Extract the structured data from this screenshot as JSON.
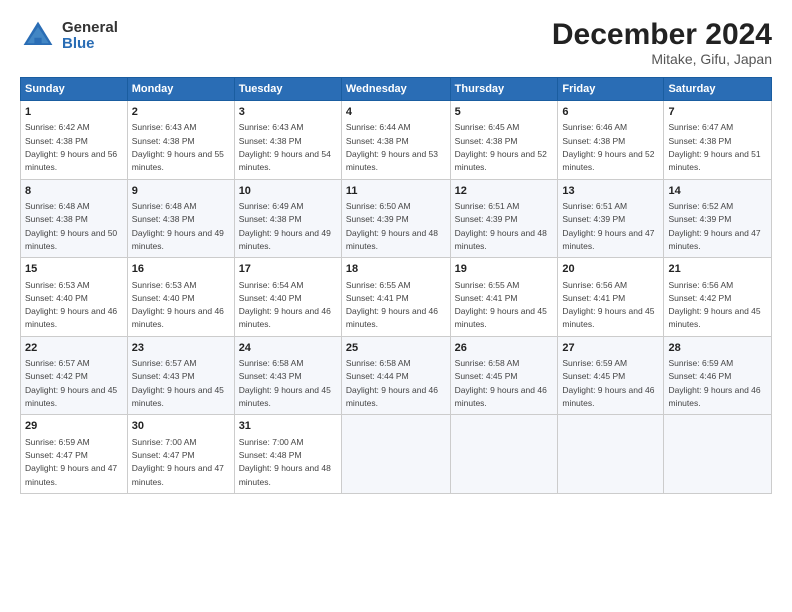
{
  "logo": {
    "general": "General",
    "blue": "Blue"
  },
  "header": {
    "month": "December 2024",
    "location": "Mitake, Gifu, Japan"
  },
  "weekdays": [
    "Sunday",
    "Monday",
    "Tuesday",
    "Wednesday",
    "Thursday",
    "Friday",
    "Saturday"
  ],
  "rows": [
    [
      {
        "day": "1",
        "sunrise": "6:42 AM",
        "sunset": "4:38 PM",
        "daylight": "9 hours and 56 minutes."
      },
      {
        "day": "2",
        "sunrise": "6:43 AM",
        "sunset": "4:38 PM",
        "daylight": "9 hours and 55 minutes."
      },
      {
        "day": "3",
        "sunrise": "6:43 AM",
        "sunset": "4:38 PM",
        "daylight": "9 hours and 54 minutes."
      },
      {
        "day": "4",
        "sunrise": "6:44 AM",
        "sunset": "4:38 PM",
        "daylight": "9 hours and 53 minutes."
      },
      {
        "day": "5",
        "sunrise": "6:45 AM",
        "sunset": "4:38 PM",
        "daylight": "9 hours and 52 minutes."
      },
      {
        "day": "6",
        "sunrise": "6:46 AM",
        "sunset": "4:38 PM",
        "daylight": "9 hours and 52 minutes."
      },
      {
        "day": "7",
        "sunrise": "6:47 AM",
        "sunset": "4:38 PM",
        "daylight": "9 hours and 51 minutes."
      }
    ],
    [
      {
        "day": "8",
        "sunrise": "6:48 AM",
        "sunset": "4:38 PM",
        "daylight": "9 hours and 50 minutes."
      },
      {
        "day": "9",
        "sunrise": "6:48 AM",
        "sunset": "4:38 PM",
        "daylight": "9 hours and 49 minutes."
      },
      {
        "day": "10",
        "sunrise": "6:49 AM",
        "sunset": "4:38 PM",
        "daylight": "9 hours and 49 minutes."
      },
      {
        "day": "11",
        "sunrise": "6:50 AM",
        "sunset": "4:39 PM",
        "daylight": "9 hours and 48 minutes."
      },
      {
        "day": "12",
        "sunrise": "6:51 AM",
        "sunset": "4:39 PM",
        "daylight": "9 hours and 48 minutes."
      },
      {
        "day": "13",
        "sunrise": "6:51 AM",
        "sunset": "4:39 PM",
        "daylight": "9 hours and 47 minutes."
      },
      {
        "day": "14",
        "sunrise": "6:52 AM",
        "sunset": "4:39 PM",
        "daylight": "9 hours and 47 minutes."
      }
    ],
    [
      {
        "day": "15",
        "sunrise": "6:53 AM",
        "sunset": "4:40 PM",
        "daylight": "9 hours and 46 minutes."
      },
      {
        "day": "16",
        "sunrise": "6:53 AM",
        "sunset": "4:40 PM",
        "daylight": "9 hours and 46 minutes."
      },
      {
        "day": "17",
        "sunrise": "6:54 AM",
        "sunset": "4:40 PM",
        "daylight": "9 hours and 46 minutes."
      },
      {
        "day": "18",
        "sunrise": "6:55 AM",
        "sunset": "4:41 PM",
        "daylight": "9 hours and 46 minutes."
      },
      {
        "day": "19",
        "sunrise": "6:55 AM",
        "sunset": "4:41 PM",
        "daylight": "9 hours and 45 minutes."
      },
      {
        "day": "20",
        "sunrise": "6:56 AM",
        "sunset": "4:41 PM",
        "daylight": "9 hours and 45 minutes."
      },
      {
        "day": "21",
        "sunrise": "6:56 AM",
        "sunset": "4:42 PM",
        "daylight": "9 hours and 45 minutes."
      }
    ],
    [
      {
        "day": "22",
        "sunrise": "6:57 AM",
        "sunset": "4:42 PM",
        "daylight": "9 hours and 45 minutes."
      },
      {
        "day": "23",
        "sunrise": "6:57 AM",
        "sunset": "4:43 PM",
        "daylight": "9 hours and 45 minutes."
      },
      {
        "day": "24",
        "sunrise": "6:58 AM",
        "sunset": "4:43 PM",
        "daylight": "9 hours and 45 minutes."
      },
      {
        "day": "25",
        "sunrise": "6:58 AM",
        "sunset": "4:44 PM",
        "daylight": "9 hours and 46 minutes."
      },
      {
        "day": "26",
        "sunrise": "6:58 AM",
        "sunset": "4:45 PM",
        "daylight": "9 hours and 46 minutes."
      },
      {
        "day": "27",
        "sunrise": "6:59 AM",
        "sunset": "4:45 PM",
        "daylight": "9 hours and 46 minutes."
      },
      {
        "day": "28",
        "sunrise": "6:59 AM",
        "sunset": "4:46 PM",
        "daylight": "9 hours and 46 minutes."
      }
    ],
    [
      {
        "day": "29",
        "sunrise": "6:59 AM",
        "sunset": "4:47 PM",
        "daylight": "9 hours and 47 minutes."
      },
      {
        "day": "30",
        "sunrise": "7:00 AM",
        "sunset": "4:47 PM",
        "daylight": "9 hours and 47 minutes."
      },
      {
        "day": "31",
        "sunrise": "7:00 AM",
        "sunset": "4:48 PM",
        "daylight": "9 hours and 48 minutes."
      },
      null,
      null,
      null,
      null
    ]
  ],
  "labels": {
    "sunrise": "Sunrise:",
    "sunset": "Sunset:",
    "daylight": "Daylight:"
  }
}
